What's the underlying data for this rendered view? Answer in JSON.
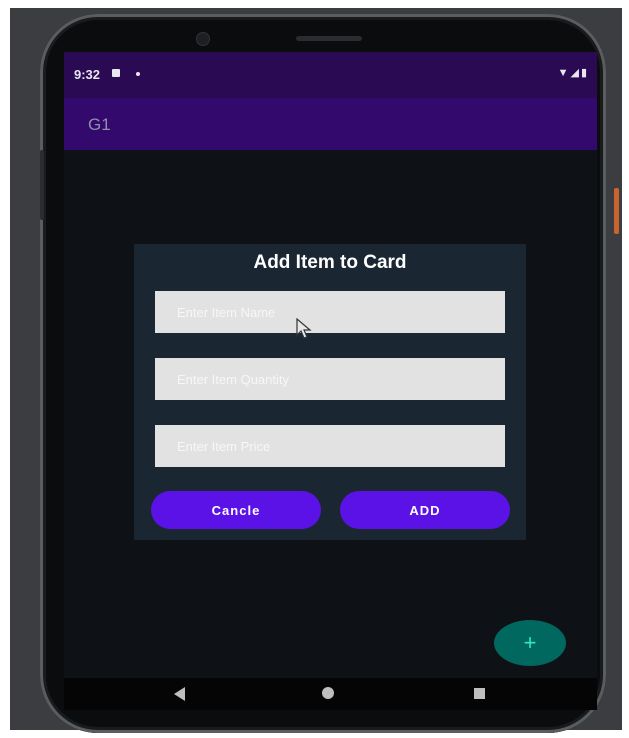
{
  "status_bar": {
    "time": "9:32",
    "right_icons": "▼◢▮"
  },
  "app_bar": {
    "title": "G1"
  },
  "dialog": {
    "title": "Add Item to Card",
    "fields": [
      {
        "placeholder": "Enter Item Name",
        "value": ""
      },
      {
        "placeholder": "Enter Item Quantity",
        "value": ""
      },
      {
        "placeholder": "Enter Item Price",
        "value": ""
      }
    ],
    "cancel_label": "Cancle",
    "add_label": "ADD"
  },
  "fab": {
    "label": "+"
  },
  "icons": {
    "notification": "notification-icon",
    "nav_back": "back-icon",
    "nav_home": "home-icon",
    "nav_recents": "recents-icon",
    "cursor": "mouse-cursor-icon"
  },
  "colors": {
    "status_bar": "#2a0a52",
    "app_bar": "#33096e",
    "dialog_bg": "#1a2732",
    "button": "#5b12e6",
    "fab": "#00685e",
    "screen_bg": "#0e1115"
  }
}
